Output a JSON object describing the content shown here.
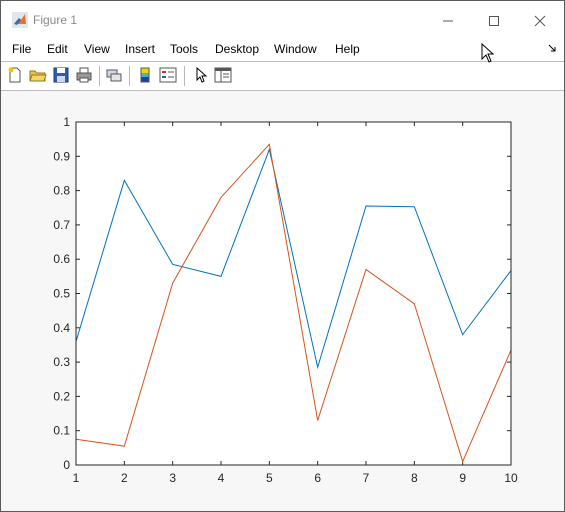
{
  "window": {
    "title": "Figure 1"
  },
  "menu": {
    "items": [
      "File",
      "Edit",
      "View",
      "Insert",
      "Tools",
      "Desktop",
      "Window",
      "Help"
    ]
  },
  "toolbar": {
    "buttons": [
      {
        "name": "new-figure-icon"
      },
      {
        "name": "open-file-icon"
      },
      {
        "name": "save-icon"
      },
      {
        "name": "print-icon"
      },
      {
        "name": "link-plot-icon"
      },
      {
        "name": "colorbar-icon"
      },
      {
        "name": "legend-icon"
      },
      {
        "name": "edit-plot-arrow-icon"
      },
      {
        "name": "property-editor-icon"
      }
    ]
  },
  "colors": {
    "series1": "#0072BD",
    "series2": "#D95319",
    "axes_bg": "#ffffff",
    "figure_bg": "#f7f7f7"
  },
  "chart_data": {
    "type": "line",
    "title": "",
    "xlabel": "",
    "ylabel": "",
    "xlim": [
      1,
      10
    ],
    "ylim": [
      0,
      1
    ],
    "grid": false,
    "x": [
      1,
      2,
      3,
      4,
      5,
      6,
      7,
      8,
      9,
      10
    ],
    "x_ticks": [
      "1",
      "2",
      "3",
      "4",
      "5",
      "6",
      "7",
      "8",
      "9",
      "10"
    ],
    "y_ticks": [
      "0",
      "0.1",
      "0.2",
      "0.3",
      "0.4",
      "0.5",
      "0.6",
      "0.7",
      "0.8",
      "0.9",
      "1"
    ],
    "series": [
      {
        "values": [
          0.36,
          0.83,
          0.585,
          0.55,
          0.92,
          0.285,
          0.755,
          0.753,
          0.38,
          0.567
        ],
        "color": "#0072BD"
      },
      {
        "values": [
          0.075,
          0.055,
          0.53,
          0.78,
          0.935,
          0.13,
          0.57,
          0.47,
          0.01,
          0.335
        ],
        "color": "#D95319"
      }
    ]
  }
}
